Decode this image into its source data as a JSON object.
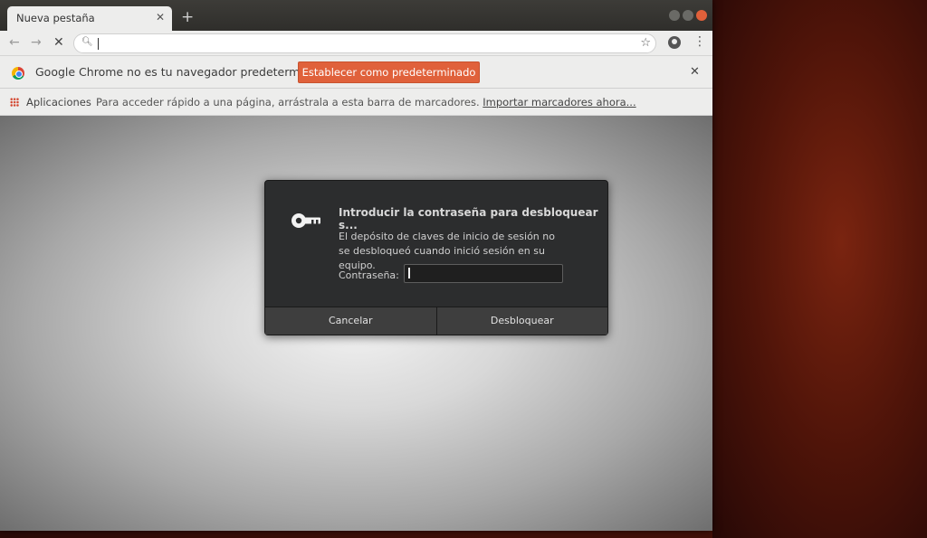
{
  "tab": {
    "title": "Nueva pestaña",
    "close": "✕",
    "new_tab": "+"
  },
  "toolbar": {
    "back": "←",
    "forward": "→",
    "stop": "✕",
    "address_value": "",
    "star": "☆",
    "menu": "⋮"
  },
  "infobar": {
    "message": "Google Chrome no es tu navegador predeterminado",
    "button_label": "Establecer como predeterminado",
    "close": "✕"
  },
  "bookmarks": {
    "apps_label": "Aplicaciones",
    "hint": "Para acceder rápido a una página, arrástrala a esta barra de marcadores.",
    "import_link": "Importar marcadores ahora..."
  },
  "dialog": {
    "title": "Introducir la contraseña para desbloquear s...",
    "message": "El depósito de claves de inicio de sesión no se desbloqueó cuando inició sesión en su equipo.",
    "password_label": "Contraseña:",
    "password_value": "",
    "cancel_label": "Cancelar",
    "unlock_label": "Desbloquear"
  },
  "colors": {
    "accent": "#e0613b",
    "dialog_bg": "#2c2d2e"
  }
}
